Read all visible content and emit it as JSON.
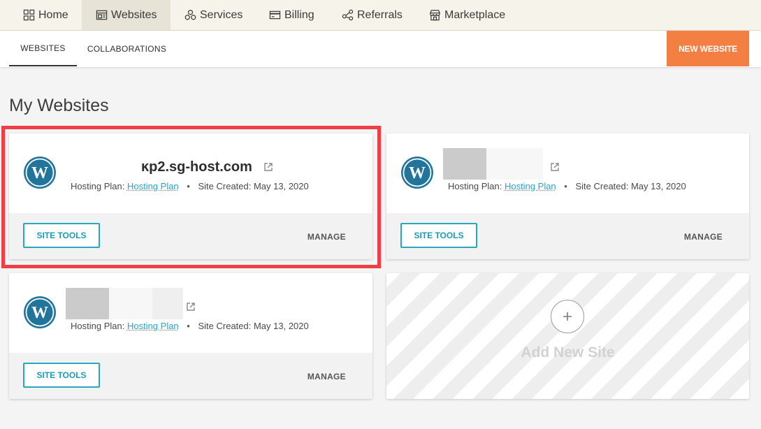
{
  "nav": {
    "items": [
      {
        "label": "Home",
        "icon": "grid-icon"
      },
      {
        "label": "Websites",
        "icon": "window-icon"
      },
      {
        "label": "Services",
        "icon": "services-icon"
      },
      {
        "label": "Billing",
        "icon": "credit-card-icon"
      },
      {
        "label": "Referrals",
        "icon": "share-icon"
      },
      {
        "label": "Marketplace",
        "icon": "store-icon"
      }
    ],
    "active": "Websites"
  },
  "subnav": {
    "tabs": [
      {
        "label": "WEBSITES"
      },
      {
        "label": "COLLABORATIONS"
      }
    ],
    "new_website_label": "NEW WEBSITE"
  },
  "page": {
    "title": "My Websites"
  },
  "sites": [
    {
      "name": "ĸp2.sg-host.com",
      "hosting_label": "Hosting Plan:",
      "hosting_plan": "Hosting Plan",
      "created": "Site Created: May 13, 2020",
      "site_tools_label": "SITE TOOLS",
      "manage_label": "MANAGE"
    },
    {
      "name": "",
      "hosting_label": "Hosting Plan:",
      "hosting_plan": "Hosting Plan",
      "created": "Site Created: May 13, 2020",
      "site_tools_label": "SITE TOOLS",
      "manage_label": "MANAGE"
    },
    {
      "name": "",
      "hosting_label": "Hosting Plan:",
      "hosting_plan": "Hosting Plan",
      "created": "Site Created: May 13, 2020",
      "site_tools_label": "SITE TOOLS",
      "manage_label": "MANAGE"
    }
  ],
  "add_site": {
    "label": "Add New Site"
  },
  "colors": {
    "accent_orange": "#f47f42",
    "link_blue": "#26a6c6",
    "wordpress_blue": "#21759b",
    "highlight_red": "#ef3e46"
  }
}
